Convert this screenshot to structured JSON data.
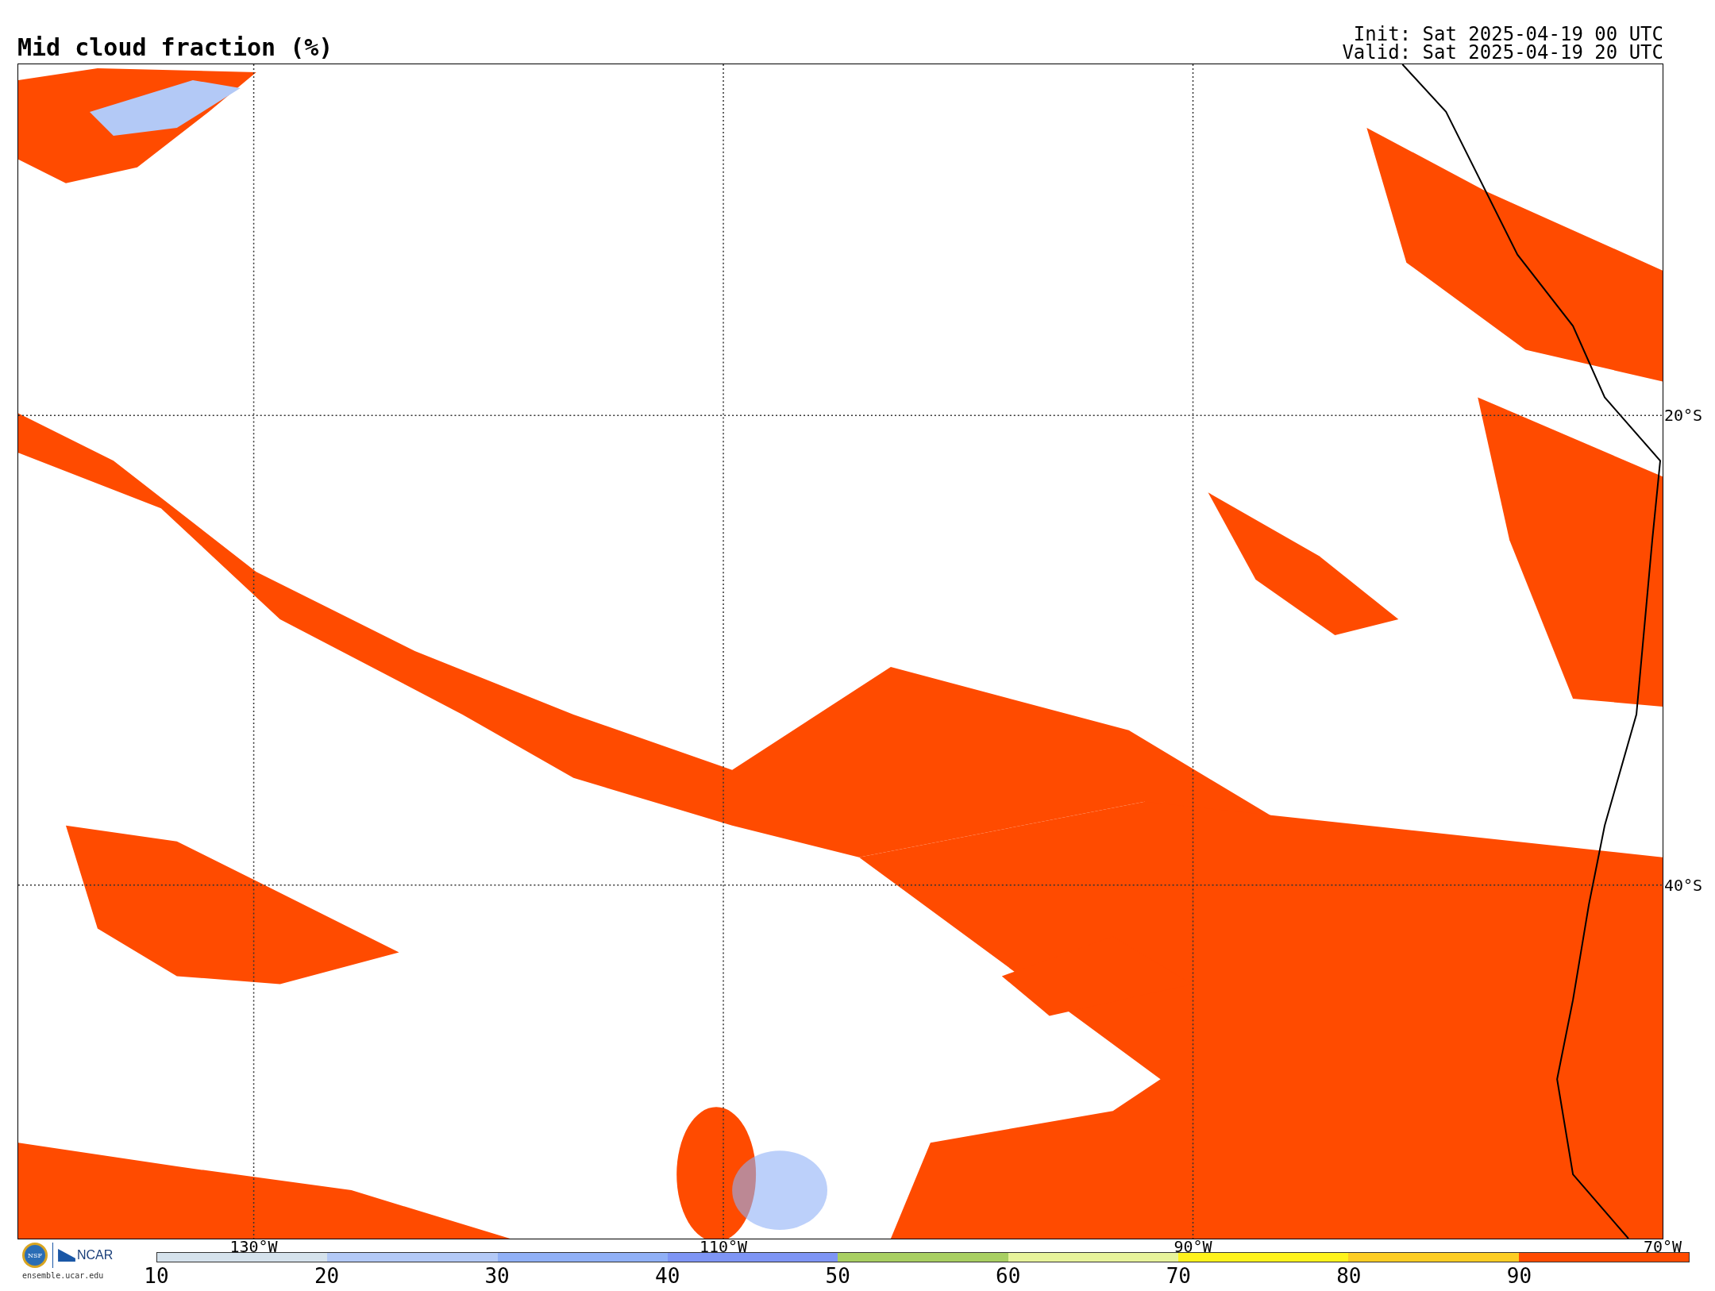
{
  "title": "Mid cloud fraction (%)",
  "run_info": [
    "Init: Sat 2025-04-19 00 UTC",
    "Valid: Sat 2025-04-19 20 UTC"
  ],
  "map": {
    "lon_labels": [
      "130°W",
      "110°W",
      "90°W",
      "70°W"
    ],
    "lat_labels": [
      "20°S",
      "40°S"
    ]
  },
  "logo": {
    "seal": "NSF",
    "org": "NCAR",
    "url": "ensemble.ucar.edu"
  },
  "colorbar": {
    "segments": [
      {
        "label": "10",
        "color": "#d5e2ec"
      },
      {
        "label": "20",
        "color": "#b3c9f6"
      },
      {
        "label": "30",
        "color": "#90b0f6"
      },
      {
        "label": "40",
        "color": "#7e95f5"
      },
      {
        "label": "50",
        "color": "#a8cf62"
      },
      {
        "label": "60",
        "color": "#e7f39b"
      },
      {
        "label": "70",
        "color": "#fff31c"
      },
      {
        "label": "80",
        "color": "#fdcd24"
      },
      {
        "label": "90",
        "color": "#ff4b00"
      }
    ]
  }
}
